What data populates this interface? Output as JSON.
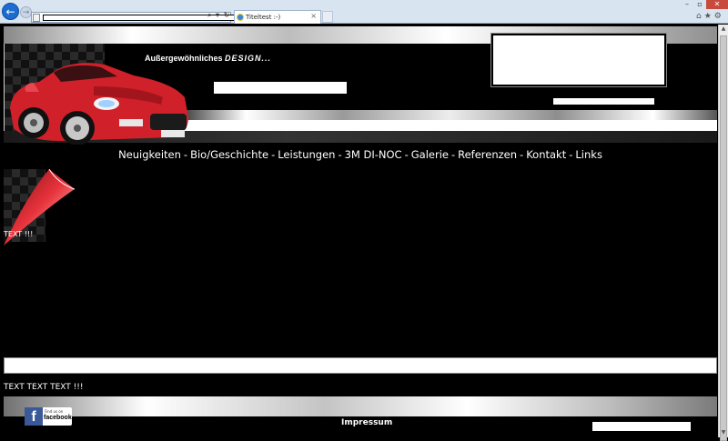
{
  "browser": {
    "tab_title": "Titeltest :-)",
    "tab_close": "×",
    "back_icon": "←",
    "forward_icon": "→",
    "address_tools": "⌕ ▾ ↻",
    "window_min": "–",
    "window_max": "▫",
    "window_close": "✕",
    "toolbar_icons": "⌂★⚙"
  },
  "header": {
    "tagline_prefix": "Außergewöhnliches ",
    "tagline_accent": "DESIGN..."
  },
  "nav": {
    "items": [
      {
        "label": "Neuigkeiten"
      },
      {
        "label": "Bio/Geschichte"
      },
      {
        "label": "Leistungen"
      },
      {
        "label": "3M DI-NOC"
      },
      {
        "label": "Galerie"
      },
      {
        "label": "Referenzen"
      },
      {
        "label": "Kontakt"
      },
      {
        "label": "Links"
      }
    ],
    "separator": "-"
  },
  "content": {
    "text": "TEXT !!!"
  },
  "footer": {
    "text": "TEXT TEXT TEXT !!!",
    "facebook_letter": "f",
    "facebook_small": "Find us on",
    "facebook_word": "facebook.",
    "impressum": "Impressum"
  },
  "colors": {
    "car_red": "#d0202a",
    "facebook_blue": "#3b5998",
    "ie_blue": "#1c6cd1",
    "close_red": "#c74a3c"
  }
}
